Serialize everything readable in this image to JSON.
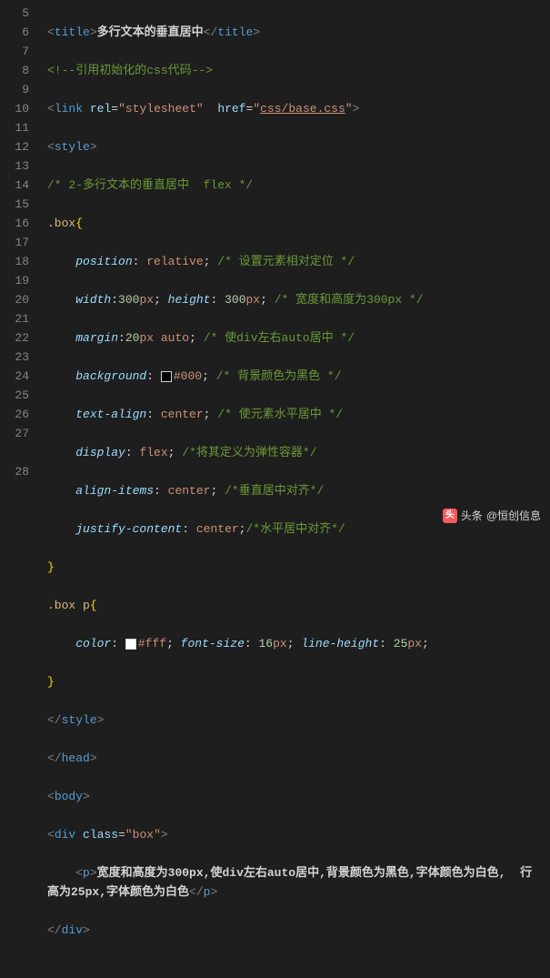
{
  "line_numbers": [
    "5",
    "6",
    "7",
    "8",
    "9",
    "10",
    "11",
    "12",
    "13",
    "14",
    "15",
    "16",
    "17",
    "18",
    "19",
    "20",
    "21",
    "22",
    "23",
    "24",
    "25",
    "26",
    "27",
    "28"
  ],
  "code": {
    "title_text": "多行文本的垂直居中",
    "html_comment": "引用初始化的css代码",
    "link_rel": "stylesheet",
    "link_href": "css/base.css",
    "css_comment_top": "2-多行文本的垂直居中  flex",
    "sel_box": ".box",
    "p_position": "position",
    "v_position": "relative",
    "c_position": "设置元素相对定位",
    "p_width": "width",
    "v_width_num": "300",
    "v_width_unit": "px",
    "p_height": "height",
    "v_height_num": "300",
    "v_height_unit": "px",
    "c_wh": "宽度和高度为300px",
    "p_margin": "margin",
    "v_margin_num": "20",
    "v_margin_unit": "px",
    "v_margin_auto": "auto",
    "c_margin": "使div左右auto居中",
    "p_bg": "background",
    "v_bg": "#000",
    "c_bg": "背景颜色为黑色",
    "p_ta": "text-align",
    "v_ta": "center",
    "c_ta": "使元素水平居中",
    "p_display": "display",
    "v_display": "flex",
    "c_display": "将其定义为弹性容器",
    "p_ai": "align-items",
    "v_ai": "center",
    "c_ai": "垂直居中对齐",
    "p_jc": "justify-content",
    "v_jc": "center",
    "c_jc": "水平居中对齐",
    "sel_boxp": ".box p",
    "p_color": "color",
    "v_color": "#fff",
    "p_fs": "font-size",
    "v_fs_num": "16",
    "v_fs_unit": "px",
    "p_lh": "line-height",
    "v_lh_num": "25",
    "v_lh_unit": "px",
    "div_class": "box",
    "p_text": "宽度和高度为300px,使div左右auto居中,背景颜色为黑色,字体颜色为白色,  行高为25px,字体颜色为白色",
    "footer_prefix": "头条",
    "footer_author": "@恒创信息",
    "footer_logo": "头"
  }
}
